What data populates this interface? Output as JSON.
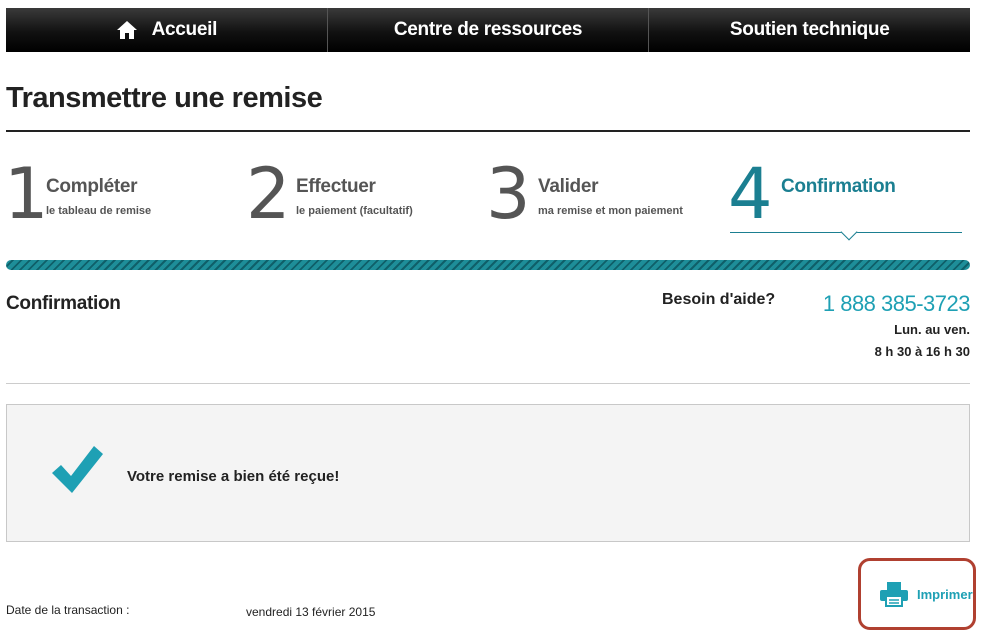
{
  "nav": {
    "home": "Accueil",
    "resources": "Centre de ressources",
    "support": "Soutien technique"
  },
  "page": {
    "title": "Transmettre une remise"
  },
  "steps": [
    {
      "num": "1",
      "label": "Compléter",
      "sub": "le tableau de remise"
    },
    {
      "num": "2",
      "label": "Effectuer",
      "sub": "le paiement (facultatif)"
    },
    {
      "num": "3",
      "label": "Valider",
      "sub": "ma remise et mon paiement"
    },
    {
      "num": "4",
      "label": "Confirmation",
      "sub": ""
    }
  ],
  "section": {
    "title": "Confirmation"
  },
  "help": {
    "label": "Besoin d'aide?",
    "phone": "1 888 385-3723",
    "days": "Lun. au ven.",
    "hours": "8 h 30 à 16 h 30"
  },
  "confirmation": {
    "message": "Votre remise a bien été reçue!"
  },
  "transaction": {
    "date_label": "Date de la transaction :",
    "date_value": "vendredi 13 février 2015"
  },
  "print": {
    "label": "Imprimer"
  },
  "colors": {
    "accent": "#1ea0b4",
    "active_step": "#1b7f91",
    "highlight_ring": "#b04030"
  },
  "progress": {
    "current_step": 4,
    "total_steps": 4
  }
}
